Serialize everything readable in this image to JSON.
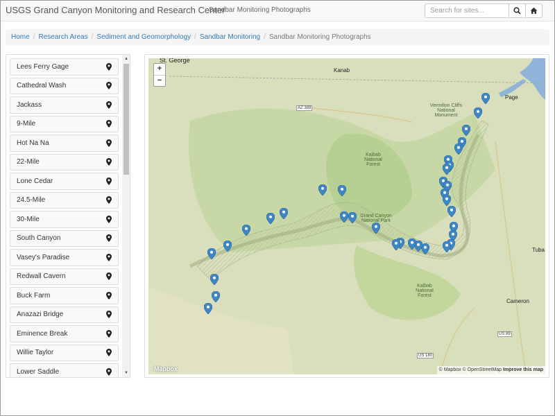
{
  "navbar": {
    "brand": "USGS Grand Canyon Monitoring and Research Center",
    "subtitle": "Sandbar Monitoring Photographs",
    "search_placeholder": "Search for sites...",
    "search_icon": "search-icon",
    "home_icon": "home-icon"
  },
  "breadcrumb": {
    "items": [
      "Home",
      "Research Areas",
      "Sediment and Geomorphology",
      "Sandbar Monitoring"
    ],
    "active": "Sandbar Monitoring Photographs"
  },
  "sidebar": {
    "item_icon": "map-marker-icon",
    "items": [
      "Lees Ferry Gage",
      "Cathedral Wash",
      "Jackass",
      "9-Mile",
      "Hot Na Na",
      "22-Mile",
      "Lone Cedar",
      "24.5-Mile",
      "30-Mile",
      "South Canyon",
      "Vasey's Paradise",
      "Redwall Cavern",
      "Buck Farm",
      "Anazazi Bridge",
      "Eminence Break",
      "Willie Taylor",
      "Lower Saddle"
    ]
  },
  "map": {
    "zoom_in": "+",
    "zoom_out": "−",
    "marker_color": "#3f87c4",
    "water_color": "#8fb3d9",
    "labels": {
      "st_george": "St. George",
      "kanab": "Kanab",
      "page": "Page",
      "tuba": "Tuba",
      "cameron": "Cameron",
      "az389": "AZ 389",
      "us89": "US 89",
      "us180": "US 180",
      "vermilion": "Vermilion Cliffs National Monument",
      "kaibab_north": "Kaibab National Forest",
      "grand_canyon": "Grand Canyon National Park",
      "kaibab_south": "Kaibab National Forest"
    },
    "attribution_prefix": "© Mapbox © OpenStreetMap",
    "attribution_link": "Improve this map",
    "logo": "Mapbox"
  }
}
